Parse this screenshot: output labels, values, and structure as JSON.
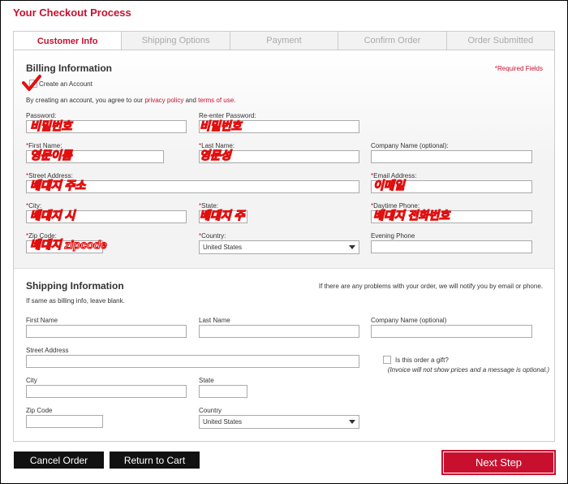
{
  "page": {
    "title": "Your Checkout Process"
  },
  "tabs": [
    {
      "label": "Customer Info",
      "active": true
    },
    {
      "label": "Shipping Options"
    },
    {
      "label": "Payment"
    },
    {
      "label": "Confirm Order"
    },
    {
      "label": "Order Submitted"
    }
  ],
  "billing": {
    "title": "Billing Information",
    "required_note": "*Required Fields",
    "create_account": "Create an Account",
    "agree_prefix": "By creating an account, you agree to our",
    "privacy_link": "privacy policy",
    "and_text": "and",
    "terms_link": "terms of use",
    "agree_suffix": ".",
    "fields": {
      "password": "Password:",
      "reenter_password": "Re-enter Password:",
      "first_name": "First Name:",
      "last_name": "Last Name:",
      "company": "Company Name (optional):",
      "street": "Street Address:",
      "email": "Email Address:",
      "city": "City:",
      "state": "State:",
      "daytime_phone": "Daytime Phone:",
      "zip": "Zip Code:",
      "country": "Country:",
      "evening_phone": "Evening Phone"
    },
    "asterisk": "*",
    "country_value": "United States",
    "annotations": {
      "password": "비밀번호",
      "reenter_password": "비밀번호",
      "first_name": "영문이름",
      "last_name": "영문성",
      "street": "배대지 주소",
      "email": "이메일",
      "city": "배대지 시",
      "state": "배대지 주",
      "daytime_phone": "배대지 전화번호",
      "zip": "배대지 zipcode"
    },
    "accent_color": "#c8102e",
    "annotation_color": "#e01010"
  },
  "shipping": {
    "title": "Shipping Information",
    "notify_note": "If there are any problems with your order, we will notify you by email or phone.",
    "same_note": "If same as billing info, leave blank.",
    "fields": {
      "first_name": "First Name",
      "last_name": "Last Name",
      "company": "Company Name (optional)",
      "street": "Street Address",
      "city": "City",
      "state": "State",
      "zip": "Zip Code",
      "country": "Country"
    },
    "country_value": "United States",
    "gift_label": "Is this order a gift?",
    "gift_note": "(Invoice will not show prices and a message is optional.)"
  },
  "buttons": {
    "cancel": "Cancel Order",
    "return": "Return to Cart",
    "next": "Next Step"
  }
}
